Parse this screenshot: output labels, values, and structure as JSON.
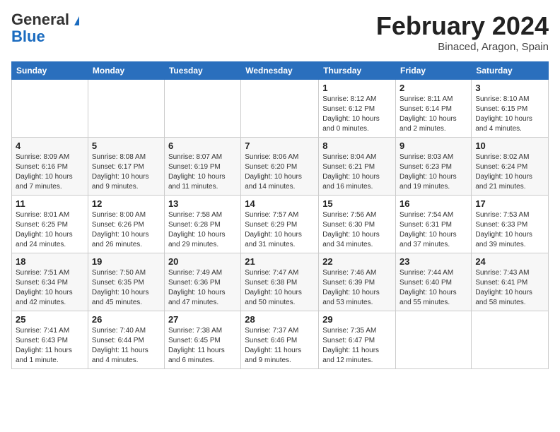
{
  "header": {
    "logo_general": "General",
    "logo_blue": "Blue",
    "title": "February 2024",
    "subtitle": "Binaced, Aragon, Spain"
  },
  "weekdays": [
    "Sunday",
    "Monday",
    "Tuesday",
    "Wednesday",
    "Thursday",
    "Friday",
    "Saturday"
  ],
  "weeks": [
    [
      {
        "num": "",
        "info": ""
      },
      {
        "num": "",
        "info": ""
      },
      {
        "num": "",
        "info": ""
      },
      {
        "num": "",
        "info": ""
      },
      {
        "num": "1",
        "info": "Sunrise: 8:12 AM\nSunset: 6:12 PM\nDaylight: 10 hours\nand 0 minutes."
      },
      {
        "num": "2",
        "info": "Sunrise: 8:11 AM\nSunset: 6:14 PM\nDaylight: 10 hours\nand 2 minutes."
      },
      {
        "num": "3",
        "info": "Sunrise: 8:10 AM\nSunset: 6:15 PM\nDaylight: 10 hours\nand 4 minutes."
      }
    ],
    [
      {
        "num": "4",
        "info": "Sunrise: 8:09 AM\nSunset: 6:16 PM\nDaylight: 10 hours\nand 7 minutes."
      },
      {
        "num": "5",
        "info": "Sunrise: 8:08 AM\nSunset: 6:17 PM\nDaylight: 10 hours\nand 9 minutes."
      },
      {
        "num": "6",
        "info": "Sunrise: 8:07 AM\nSunset: 6:19 PM\nDaylight: 10 hours\nand 11 minutes."
      },
      {
        "num": "7",
        "info": "Sunrise: 8:06 AM\nSunset: 6:20 PM\nDaylight: 10 hours\nand 14 minutes."
      },
      {
        "num": "8",
        "info": "Sunrise: 8:04 AM\nSunset: 6:21 PM\nDaylight: 10 hours\nand 16 minutes."
      },
      {
        "num": "9",
        "info": "Sunrise: 8:03 AM\nSunset: 6:23 PM\nDaylight: 10 hours\nand 19 minutes."
      },
      {
        "num": "10",
        "info": "Sunrise: 8:02 AM\nSunset: 6:24 PM\nDaylight: 10 hours\nand 21 minutes."
      }
    ],
    [
      {
        "num": "11",
        "info": "Sunrise: 8:01 AM\nSunset: 6:25 PM\nDaylight: 10 hours\nand 24 minutes."
      },
      {
        "num": "12",
        "info": "Sunrise: 8:00 AM\nSunset: 6:26 PM\nDaylight: 10 hours\nand 26 minutes."
      },
      {
        "num": "13",
        "info": "Sunrise: 7:58 AM\nSunset: 6:28 PM\nDaylight: 10 hours\nand 29 minutes."
      },
      {
        "num": "14",
        "info": "Sunrise: 7:57 AM\nSunset: 6:29 PM\nDaylight: 10 hours\nand 31 minutes."
      },
      {
        "num": "15",
        "info": "Sunrise: 7:56 AM\nSunset: 6:30 PM\nDaylight: 10 hours\nand 34 minutes."
      },
      {
        "num": "16",
        "info": "Sunrise: 7:54 AM\nSunset: 6:31 PM\nDaylight: 10 hours\nand 37 minutes."
      },
      {
        "num": "17",
        "info": "Sunrise: 7:53 AM\nSunset: 6:33 PM\nDaylight: 10 hours\nand 39 minutes."
      }
    ],
    [
      {
        "num": "18",
        "info": "Sunrise: 7:51 AM\nSunset: 6:34 PM\nDaylight: 10 hours\nand 42 minutes."
      },
      {
        "num": "19",
        "info": "Sunrise: 7:50 AM\nSunset: 6:35 PM\nDaylight: 10 hours\nand 45 minutes."
      },
      {
        "num": "20",
        "info": "Sunrise: 7:49 AM\nSunset: 6:36 PM\nDaylight: 10 hours\nand 47 minutes."
      },
      {
        "num": "21",
        "info": "Sunrise: 7:47 AM\nSunset: 6:38 PM\nDaylight: 10 hours\nand 50 minutes."
      },
      {
        "num": "22",
        "info": "Sunrise: 7:46 AM\nSunset: 6:39 PM\nDaylight: 10 hours\nand 53 minutes."
      },
      {
        "num": "23",
        "info": "Sunrise: 7:44 AM\nSunset: 6:40 PM\nDaylight: 10 hours\nand 55 minutes."
      },
      {
        "num": "24",
        "info": "Sunrise: 7:43 AM\nSunset: 6:41 PM\nDaylight: 10 hours\nand 58 minutes."
      }
    ],
    [
      {
        "num": "25",
        "info": "Sunrise: 7:41 AM\nSunset: 6:43 PM\nDaylight: 11 hours\nand 1 minute."
      },
      {
        "num": "26",
        "info": "Sunrise: 7:40 AM\nSunset: 6:44 PM\nDaylight: 11 hours\nand 4 minutes."
      },
      {
        "num": "27",
        "info": "Sunrise: 7:38 AM\nSunset: 6:45 PM\nDaylight: 11 hours\nand 6 minutes."
      },
      {
        "num": "28",
        "info": "Sunrise: 7:37 AM\nSunset: 6:46 PM\nDaylight: 11 hours\nand 9 minutes."
      },
      {
        "num": "29",
        "info": "Sunrise: 7:35 AM\nSunset: 6:47 PM\nDaylight: 11 hours\nand 12 minutes."
      },
      {
        "num": "",
        "info": ""
      },
      {
        "num": "",
        "info": ""
      }
    ]
  ]
}
